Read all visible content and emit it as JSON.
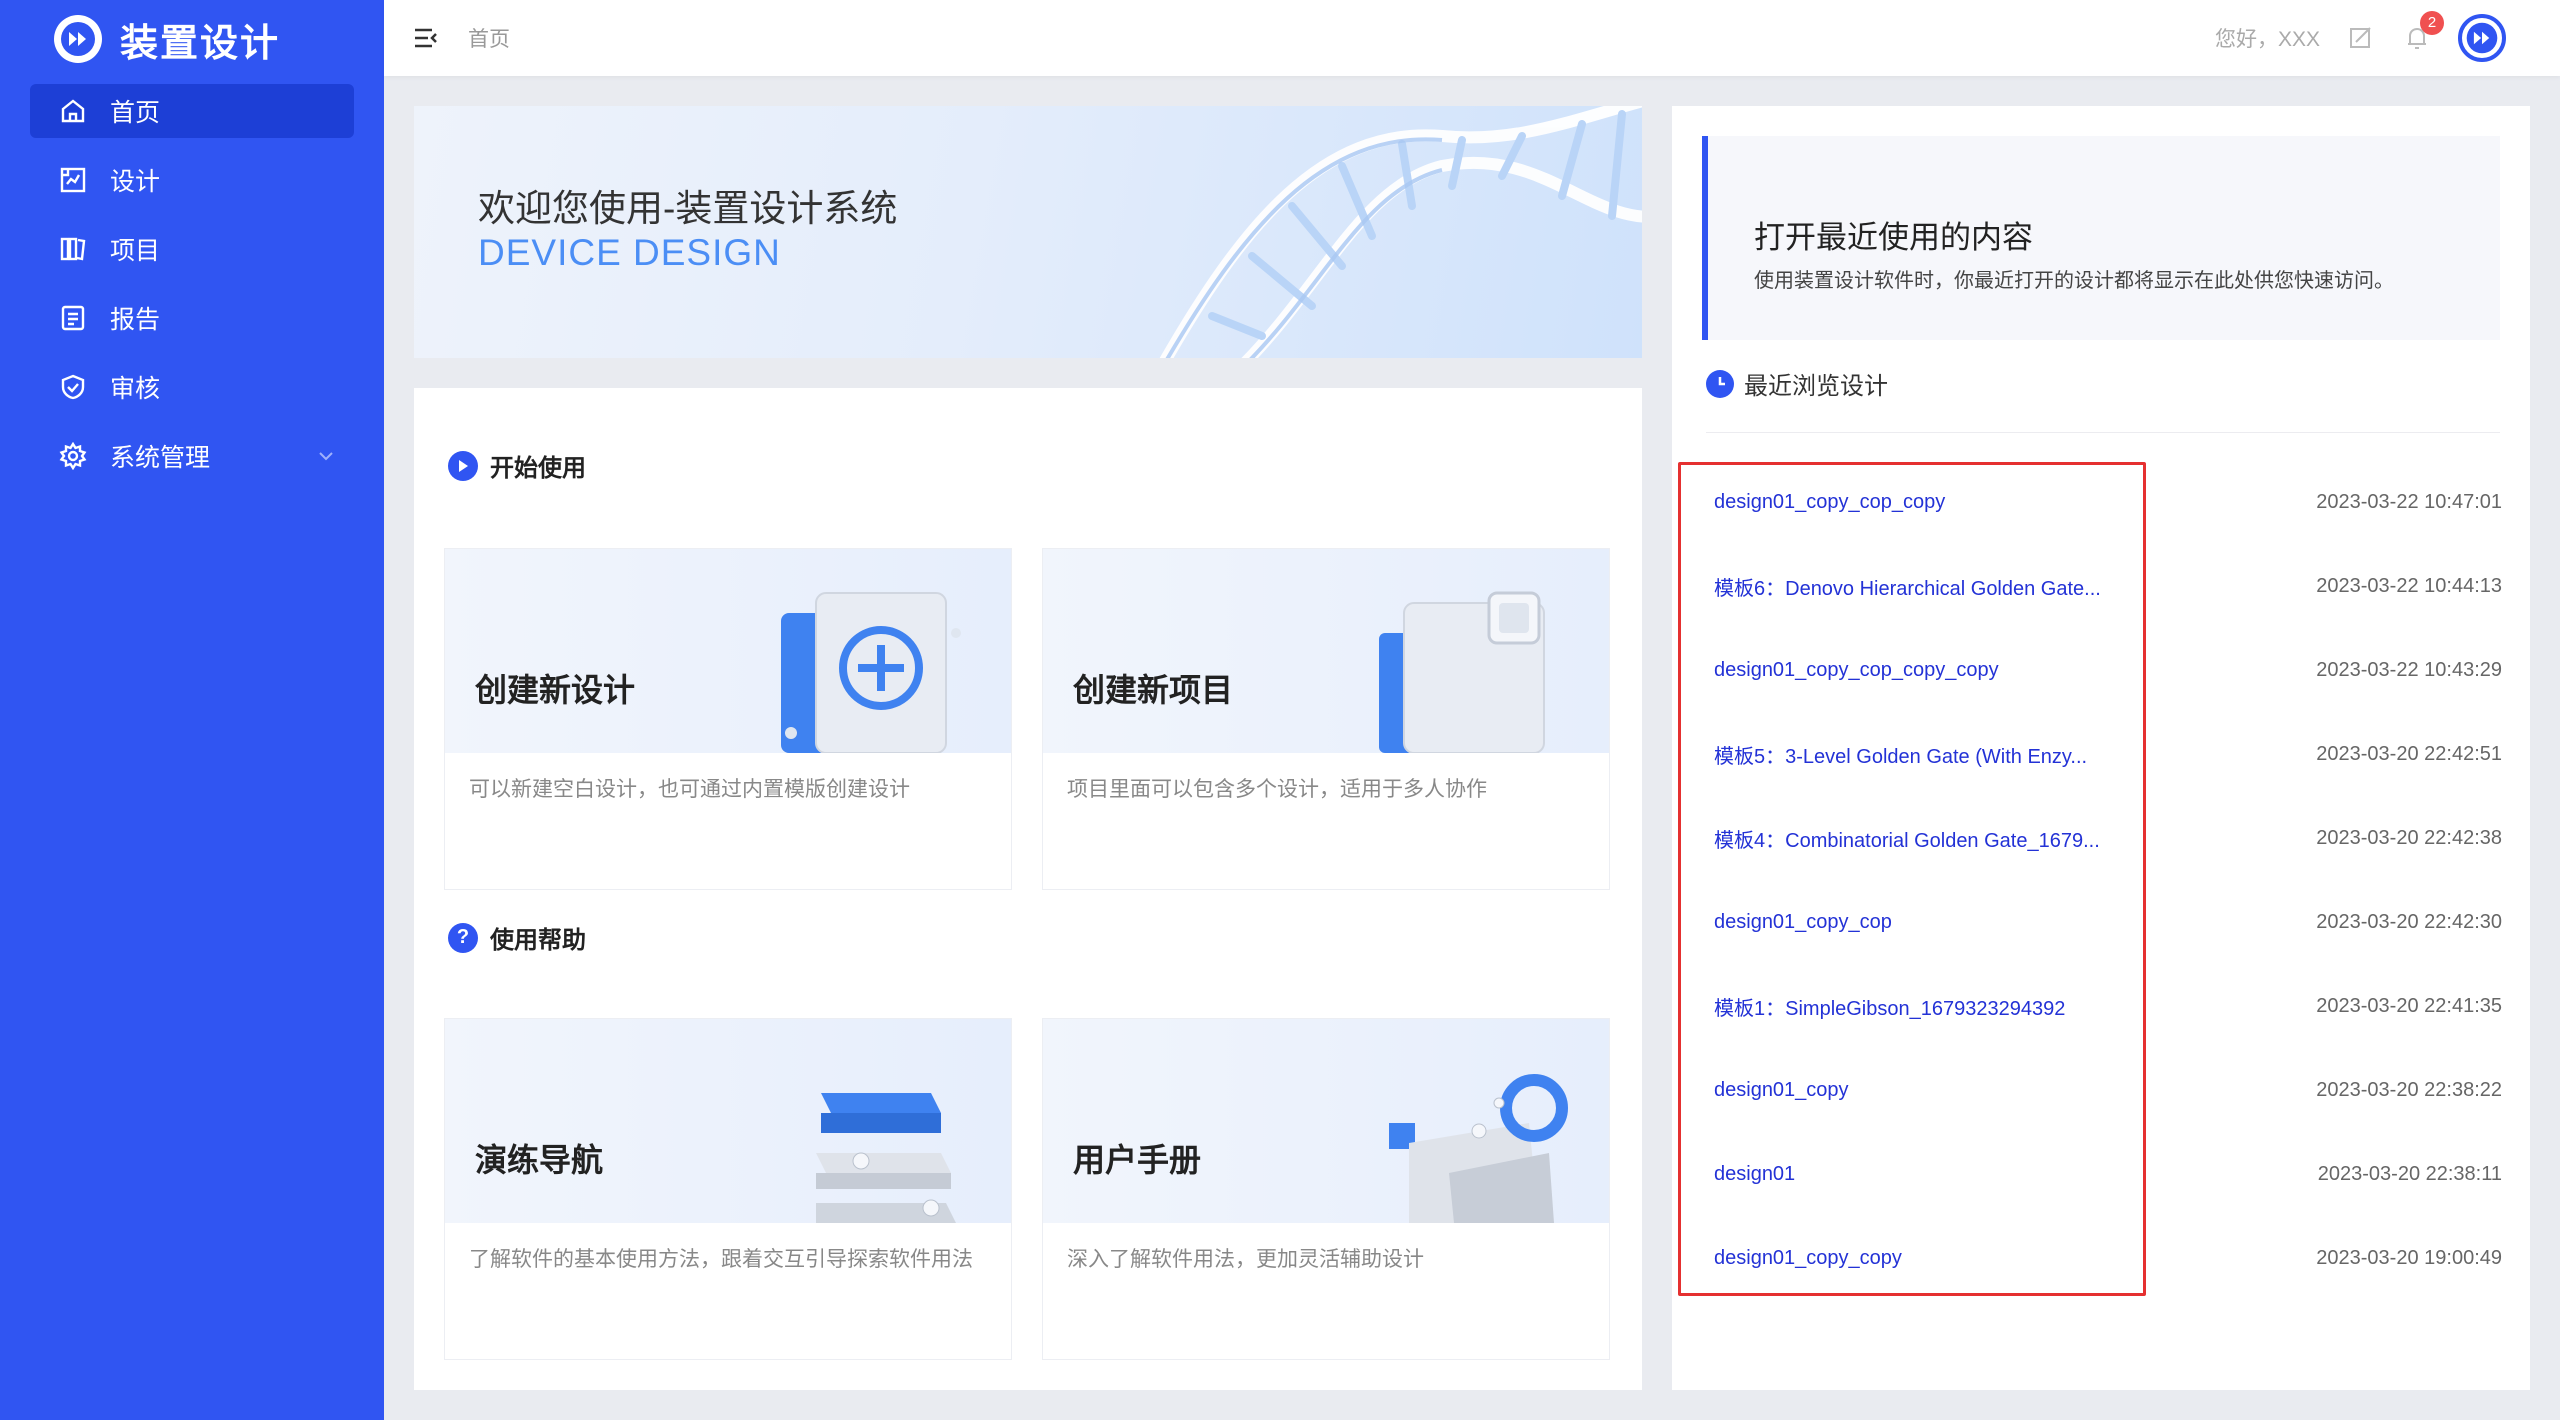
{
  "brand": {
    "title": "装置设计"
  },
  "sidebar": {
    "items": [
      {
        "label": "首页",
        "icon": "home-icon"
      },
      {
        "label": "设计",
        "icon": "design-icon"
      },
      {
        "label": "项目",
        "icon": "project-icon"
      },
      {
        "label": "报告",
        "icon": "report-icon"
      },
      {
        "label": "审核",
        "icon": "shield-icon"
      },
      {
        "label": "系统管理",
        "icon": "gear-icon"
      }
    ]
  },
  "header": {
    "breadcrumb": "首页",
    "greeting": "您好，XXX",
    "notification_count": "2"
  },
  "banner": {
    "title": "欢迎您使用-装置设计系统",
    "subtitle": "DEVICE DESIGN"
  },
  "start": {
    "heading": "开始使用",
    "cards": [
      {
        "title": "创建新设计",
        "desc": "可以新建空白设计，也可通过内置模版创建设计"
      },
      {
        "title": "创建新项目",
        "desc": "项目里面可以包含多个设计，适用于多人协作"
      }
    ]
  },
  "help": {
    "heading": "使用帮助",
    "cards": [
      {
        "title": "演练导航",
        "desc": "了解软件的基本使用方法，跟着交互引导探索软件用法"
      },
      {
        "title": "用户手册",
        "desc": "深入了解软件用法，更加灵活辅助设计"
      }
    ]
  },
  "recent": {
    "title": "打开最近使用的内容",
    "desc": "使用装置设计软件时，你最近打开的设计都将显示在此处供您快速访问。",
    "browse_heading": "最近浏览设计",
    "items": [
      {
        "name": "design01_copy_cop_copy",
        "time": "2023-03-22 10:47:01"
      },
      {
        "name": "模板6：Denovo Hierarchical Golden Gate...",
        "time": "2023-03-22 10:44:13"
      },
      {
        "name": "design01_copy_cop_copy_copy",
        "time": "2023-03-22 10:43:29"
      },
      {
        "name": "模板5：3-Level Golden Gate (With Enzy...",
        "time": "2023-03-20 22:42:51"
      },
      {
        "name": "模板4：Combinatorial Golden Gate_1679...",
        "time": "2023-03-20 22:42:38"
      },
      {
        "name": "design01_copy_cop",
        "time": "2023-03-20 22:42:30"
      },
      {
        "name": "模板1：SimpleGibson_1679323294392",
        "time": "2023-03-20 22:41:35"
      },
      {
        "name": "design01_copy",
        "time": "2023-03-20 22:38:22"
      },
      {
        "name": "design01",
        "time": "2023-03-20 22:38:11"
      },
      {
        "name": "design01_copy_copy",
        "time": "2023-03-20 19:00:49"
      }
    ]
  },
  "colors": {
    "primary": "#3055f2",
    "link": "#2332d6",
    "highlight": "#e53030"
  }
}
